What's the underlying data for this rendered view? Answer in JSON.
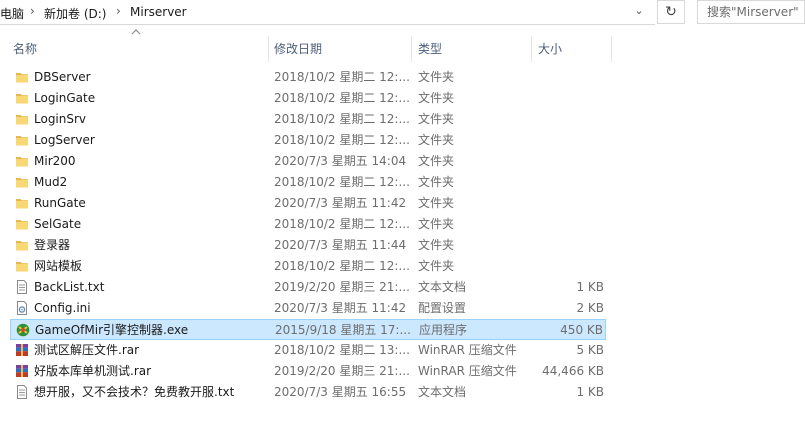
{
  "address": {
    "crumbs": [
      "电脑",
      "新加卷 (D:)",
      "Mirserver"
    ],
    "search_placeholder": "搜索\"Mirserver\""
  },
  "columns": {
    "name": "名称",
    "date": "修改日期",
    "type": "类型",
    "size": "大小"
  },
  "files": [
    {
      "name": "DBServer",
      "date": "2018/10/2 星期二 12:...",
      "type": "文件夹",
      "size": "",
      "icon": "folder-icon"
    },
    {
      "name": "LoginGate",
      "date": "2018/10/2 星期二 12:...",
      "type": "文件夹",
      "size": "",
      "icon": "folder-icon"
    },
    {
      "name": "LoginSrv",
      "date": "2018/10/2 星期二 12:...",
      "type": "文件夹",
      "size": "",
      "icon": "folder-icon"
    },
    {
      "name": "LogServer",
      "date": "2018/10/2 星期二 12:...",
      "type": "文件夹",
      "size": "",
      "icon": "folder-icon"
    },
    {
      "name": "Mir200",
      "date": "2020/7/3 星期五 14:04",
      "type": "文件夹",
      "size": "",
      "icon": "folder-icon"
    },
    {
      "name": "Mud2",
      "date": "2018/10/2 星期二 12:...",
      "type": "文件夹",
      "size": "",
      "icon": "folder-icon"
    },
    {
      "name": "RunGate",
      "date": "2020/7/3 星期五 11:42",
      "type": "文件夹",
      "size": "",
      "icon": "folder-icon"
    },
    {
      "name": "SelGate",
      "date": "2018/10/2 星期二 12:...",
      "type": "文件夹",
      "size": "",
      "icon": "folder-icon"
    },
    {
      "name": "登录器",
      "date": "2020/7/3 星期五 11:44",
      "type": "文件夹",
      "size": "",
      "icon": "folder-icon"
    },
    {
      "name": "网站模板",
      "date": "2018/10/2 星期二 12:...",
      "type": "文件夹",
      "size": "",
      "icon": "folder-icon"
    },
    {
      "name": "BackList.txt",
      "date": "2019/2/20 星期三 21:...",
      "type": "文本文档",
      "size": "1 KB",
      "icon": "text-file-icon"
    },
    {
      "name": "Config.ini",
      "date": "2020/7/3 星期五 11:42",
      "type": "配置设置",
      "size": "2 KB",
      "icon": "config-file-icon"
    },
    {
      "name": "GameOfMir引擎控制器.exe",
      "date": "2015/9/18 星期五 17:...",
      "type": "应用程序",
      "size": "450 KB",
      "icon": "app-icon"
    },
    {
      "name": "测试区解压文件.rar",
      "date": "2018/10/2 星期二 13:...",
      "type": "WinRAR 压缩文件",
      "size": "5 KB",
      "icon": "rar-icon"
    },
    {
      "name": "好版本库单机测试.rar",
      "date": "2019/2/20 星期三 21:...",
      "type": "WinRAR 压缩文件",
      "size": "44,466 KB",
      "icon": "rar-icon"
    },
    {
      "name": "想开服，又不会技术？免费教开服.txt",
      "date": "2020/7/3 星期五 16:55",
      "type": "文本文档",
      "size": "1 KB",
      "icon": "text-file-icon"
    }
  ],
  "selected_index": 12
}
